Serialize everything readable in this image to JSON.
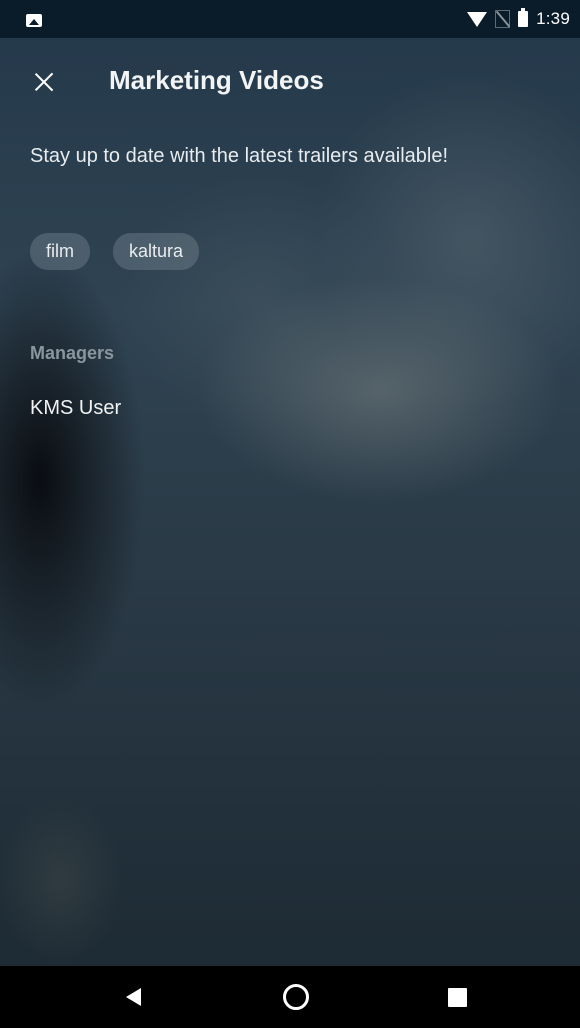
{
  "status_bar": {
    "time": "1:39",
    "icons": [
      "image-notification-icon",
      "wifi-icon",
      "no-sim-icon",
      "battery-icon"
    ]
  },
  "toolbar": {
    "close_icon": "close-icon",
    "title": "Marketing Videos"
  },
  "channel": {
    "description": "Stay up to date with the latest trailers available!",
    "tags": [
      {
        "label": "film"
      },
      {
        "label": "kaltura"
      }
    ],
    "managers_label": "Managers",
    "managers": [
      {
        "name": "KMS User"
      }
    ]
  },
  "nav_bar": {
    "icons": [
      "back-icon",
      "home-icon",
      "recent-apps-icon"
    ]
  },
  "colors": {
    "status_bar_bg": "#0a1b29",
    "text_primary": "#f2f4f5",
    "section_label": "#8a969e",
    "tag_bg": "rgba(120,135,145,0.42)",
    "nav_bar_bg": "#000000"
  }
}
